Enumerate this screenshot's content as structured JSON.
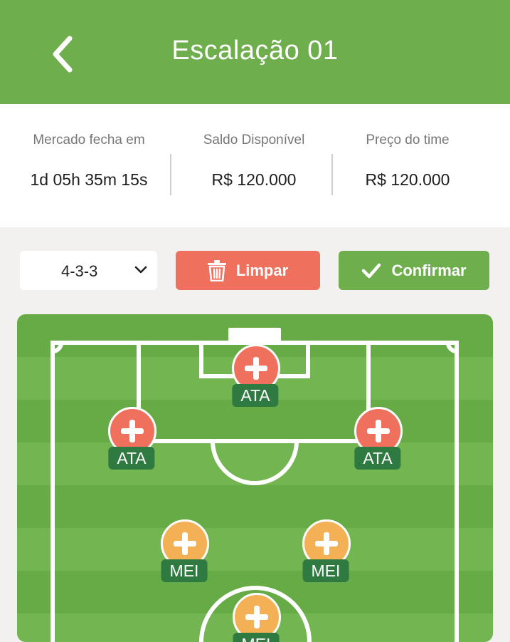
{
  "header": {
    "title": "Escalação 01",
    "back_icon": "chevron-left-icon",
    "color": "#6fae4d"
  },
  "info": [
    {
      "label": "Mercado fecha em",
      "value": "1d 05h 35m 15s"
    },
    {
      "label": "Saldo Disponível",
      "value": "R$ 120.000"
    },
    {
      "label": "Preço do time",
      "value": "R$ 120.000"
    }
  ],
  "controls": {
    "formation": "4-3-3",
    "formation_icon": "chevron-down-icon",
    "clear_label": "Limpar",
    "clear_icon": "trash-icon",
    "clear_color": "#f0705e",
    "confirm_label": "Confirmar",
    "confirm_icon": "check-icon",
    "confirm_color": "#6fae4d"
  },
  "field": {
    "slots": [
      {
        "position": "ATA",
        "icon": "plus-icon",
        "color": "#f0705e"
      },
      {
        "position": "ATA",
        "icon": "plus-icon",
        "color": "#f0705e"
      },
      {
        "position": "ATA",
        "icon": "plus-icon",
        "color": "#f0705e"
      },
      {
        "position": "MEI",
        "icon": "plus-icon",
        "color": "#f3b055"
      },
      {
        "position": "MEI",
        "icon": "plus-icon",
        "color": "#f3b055"
      },
      {
        "position": "MEI",
        "icon": "plus-icon",
        "color": "#f3b055"
      }
    ]
  }
}
